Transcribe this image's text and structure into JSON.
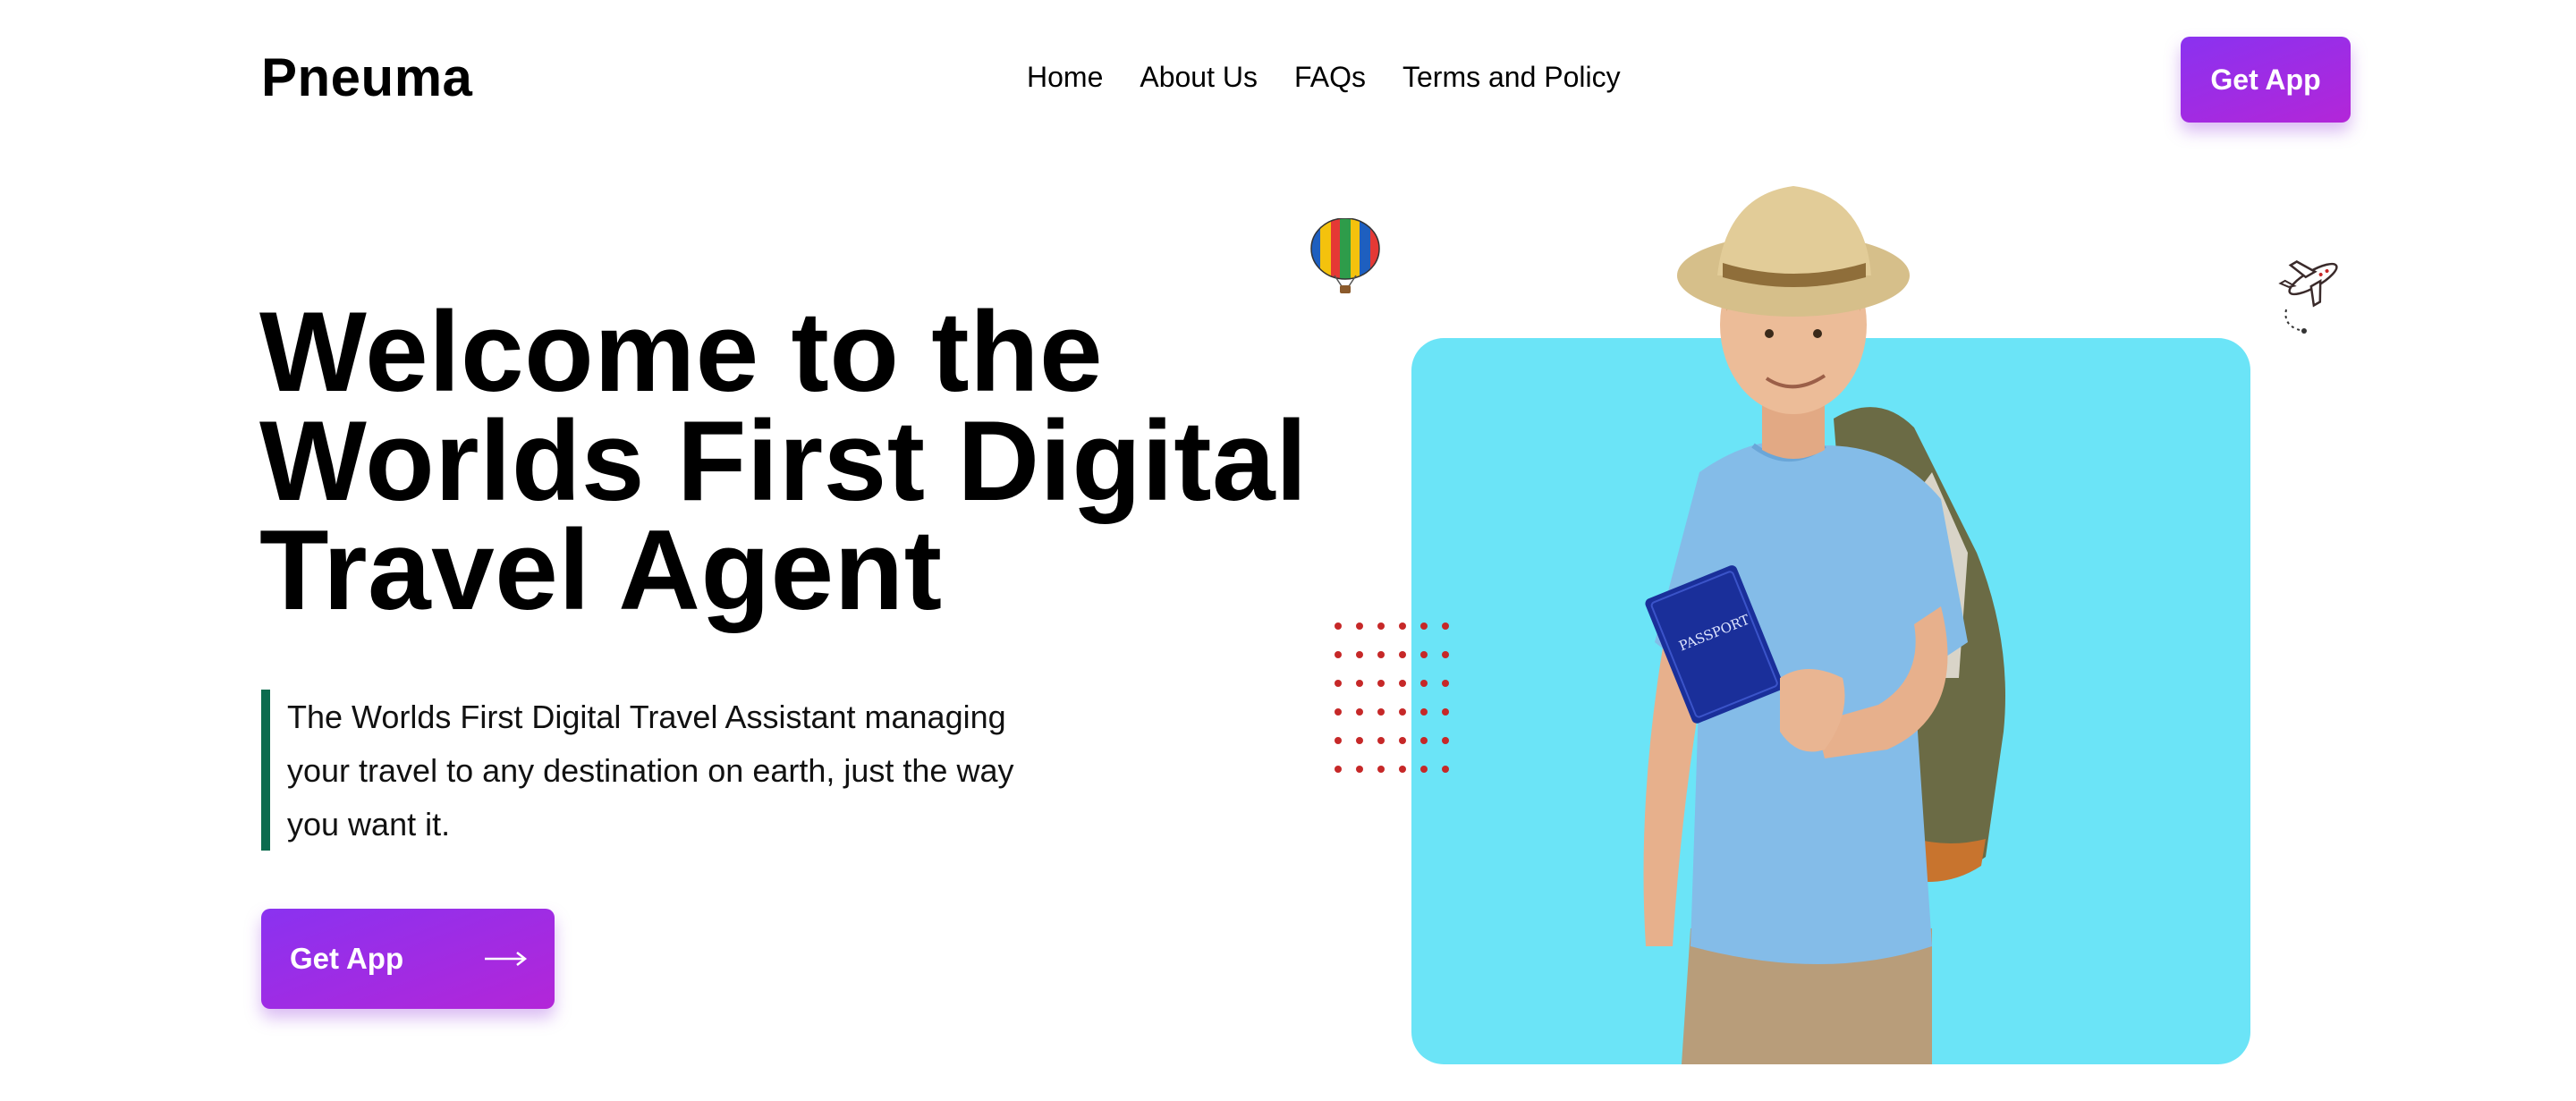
{
  "brand": {
    "name": "Pneuma"
  },
  "nav": {
    "items": [
      {
        "label": "Home"
      },
      {
        "label": "About Us"
      },
      {
        "label": "FAQs"
      },
      {
        "label": "Terms and Policy"
      }
    ]
  },
  "header": {
    "cta_label": "Get App"
  },
  "hero": {
    "title_lines": [
      "Welcome to the",
      "Worlds First Digital",
      "Travel Agent"
    ],
    "description_lines": [
      "The Worlds First Digital Travel Assistant managing",
      "your travel to any destination on earth, just the way",
      "you want it."
    ],
    "cta_label": "Get App",
    "cta_icon": "arrow-right-icon"
  },
  "illustration": {
    "passport_text": "PASSPORT",
    "icons": [
      "hot-air-balloon-icon",
      "airplane-icon",
      "dot-grid-decoration"
    ]
  },
  "colors": {
    "accent_gradient_start": "#8a32f0",
    "accent_gradient_end": "#b326d8",
    "panel": "#6be4f7",
    "quote_bar": "#0c6b4e",
    "dots": "#c62828"
  }
}
